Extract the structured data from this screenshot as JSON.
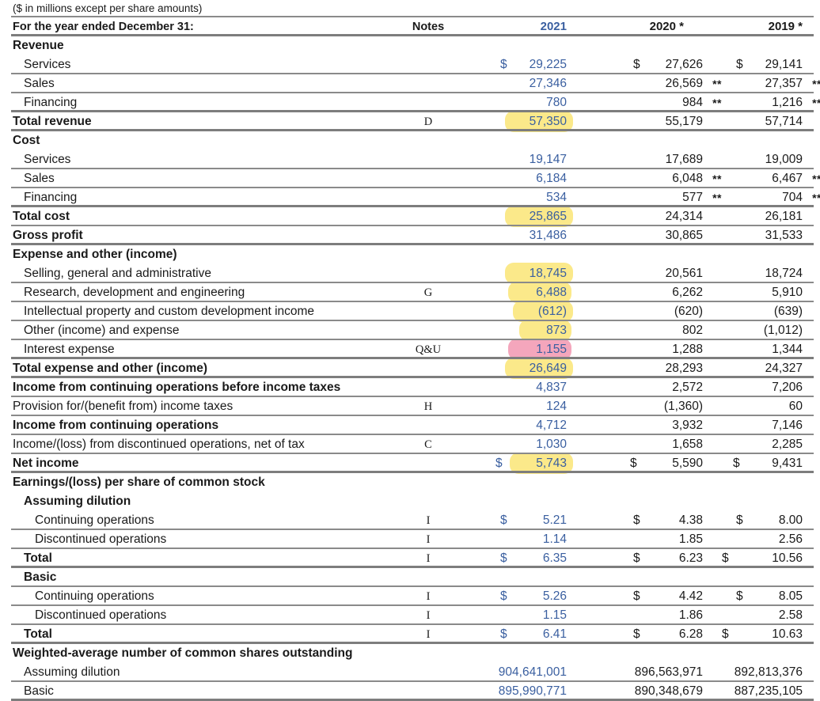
{
  "document": {
    "unit_note": "($ in millions except per share amounts)",
    "header": {
      "line_label": "For the year ended December 31:",
      "notes_label": "Notes",
      "col_2021": "2021",
      "col_2020": "2020 *",
      "col_2019": "2019 *"
    },
    "colors": {
      "accent_blue": "#3a5fa0",
      "highlight_yellow": "#fbe98a",
      "highlight_pink": "#f4a6bc",
      "rule_gray": "#8a8a8a",
      "text_dark": "#1a1a1a"
    }
  },
  "rows": [
    {
      "label": "Revenue",
      "notes": "",
      "v2021": "",
      "v2020": "",
      "v2019": ""
    },
    {
      "label": "Services",
      "notes": "",
      "cur2021": "$",
      "v2021": "29,225",
      "cur2020": "$",
      "v2020": "27,626",
      "cur2019": "$",
      "v2019": "29,141"
    },
    {
      "label": "Sales",
      "notes": "",
      "v2021": "27,346",
      "v2020": "26,569",
      "s2020": "**",
      "v2019": "27,357",
      "s2019": "**"
    },
    {
      "label": "Financing",
      "notes": "",
      "v2021": "780",
      "v2020": "984",
      "s2020": "**",
      "v2019": "1,216",
      "s2019": "**"
    },
    {
      "label": "Total revenue",
      "notes": "D",
      "v2021": "57,350",
      "v2020": "55,179",
      "v2019": "57,714"
    },
    {
      "label": "Cost",
      "notes": "",
      "v2021": "",
      "v2020": "",
      "v2019": ""
    },
    {
      "label": "Services",
      "notes": "",
      "v2021": "19,147",
      "v2020": "17,689",
      "v2019": "19,009"
    },
    {
      "label": "Sales",
      "notes": "",
      "v2021": "6,184",
      "v2020": "6,048",
      "s2020": "**",
      "v2019": "6,467",
      "s2019": "**"
    },
    {
      "label": "Financing",
      "notes": "",
      "v2021": "534",
      "v2020": "577",
      "s2020": "**",
      "v2019": "704",
      "s2019": "**"
    },
    {
      "label": "Total cost",
      "notes": "",
      "v2021": "25,865",
      "v2020": "24,314",
      "v2019": "26,181"
    },
    {
      "label": "Gross profit",
      "notes": "",
      "v2021": "31,486",
      "v2020": "30,865",
      "v2019": "31,533"
    },
    {
      "label": "Expense and other (income)",
      "notes": "",
      "v2021": "",
      "v2020": "",
      "v2019": ""
    },
    {
      "label": "Selling, general and administrative",
      "notes": "",
      "v2021": "18,745",
      "v2020": "20,561",
      "v2019": "18,724"
    },
    {
      "label": "Research, development and engineering",
      "notes": "G",
      "v2021": "6,488",
      "v2020": "6,262",
      "v2019": "5,910"
    },
    {
      "label": "Intellectual property and custom development income",
      "notes": "",
      "v2021": "(612)",
      "v2020": "(620)",
      "v2019": "(639)"
    },
    {
      "label": "Other (income) and expense",
      "notes": "",
      "v2021": "873",
      "v2020": "802",
      "v2019": "(1,012)"
    },
    {
      "label": "Interest expense",
      "notes": "Q&U",
      "v2021": "1,155",
      "v2020": "1,288",
      "v2019": "1,344"
    },
    {
      "label": "Total expense and other (income)",
      "notes": "",
      "v2021": "26,649",
      "v2020": "28,293",
      "v2019": "24,327"
    },
    {
      "label": "Income from continuing operations before income taxes",
      "notes": "",
      "v2021": "4,837",
      "v2020": "2,572",
      "v2019": "7,206"
    },
    {
      "label": "Provision for/(benefit from) income taxes",
      "notes": "H",
      "v2021": "124",
      "v2020": "(1,360)",
      "v2019": "60"
    },
    {
      "label": "Income from continuing operations",
      "notes": "",
      "v2021": "4,712",
      "v2020": "3,932",
      "v2019": "7,146"
    },
    {
      "label": "Income/(loss) from discontinued operations, net of tax",
      "notes": "C",
      "v2021": "1,030",
      "v2020": "1,658",
      "v2019": "2,285"
    },
    {
      "label": "Net income",
      "notes": "",
      "cur2021": "$",
      "v2021": "5,743",
      "cur2020": "$",
      "v2020": "5,590",
      "cur2019": "$",
      "v2019": "9,431"
    },
    {
      "label": "Earnings/(loss) per share of common stock",
      "notes": "",
      "v2021": "",
      "v2020": "",
      "v2019": ""
    },
    {
      "label": "Assuming dilution",
      "notes": "",
      "v2021": "",
      "v2020": "",
      "v2019": ""
    },
    {
      "label": "Continuing operations",
      "notes": "I",
      "cur2021": "$",
      "v2021": "5.21",
      "cur2020": "$",
      "v2020": "4.38",
      "cur2019": "$",
      "v2019": "8.00"
    },
    {
      "label": "Discontinued operations",
      "notes": "I",
      "v2021": "1.14",
      "v2020": "1.85",
      "v2019": "2.56"
    },
    {
      "label": "Total",
      "notes": "I",
      "cur2021": "$",
      "v2021": "6.35",
      "cur2020": "$",
      "v2020": "6.23",
      "cur2019": "$",
      "v2019": "10.56"
    },
    {
      "label": "Basic",
      "notes": "",
      "v2021": "",
      "v2020": "",
      "v2019": ""
    },
    {
      "label": "Continuing operations",
      "notes": "I",
      "cur2021": "$",
      "v2021": "5.26",
      "cur2020": "$",
      "v2020": "4.42",
      "cur2019": "$",
      "v2019": "8.05"
    },
    {
      "label": "Discontinued operations",
      "notes": "I",
      "v2021": "1.15",
      "v2020": "1.86",
      "v2019": "2.58"
    },
    {
      "label": "Total",
      "notes": "I",
      "cur2021": "$",
      "v2021": "6.41",
      "cur2020": "$",
      "v2020": "6.28",
      "cur2019": "$",
      "v2019": "10.63"
    },
    {
      "label": "Weighted-average number of common shares outstanding",
      "notes": "",
      "v2021": "",
      "v2020": "",
      "v2019": ""
    },
    {
      "label": "Assuming dilution",
      "notes": "",
      "v2021": "904,641,001",
      "v2020": "896,563,971",
      "v2019": "892,813,376"
    },
    {
      "label": "Basic",
      "notes": "",
      "v2021": "895,990,771",
      "v2020": "890,348,679",
      "v2019": "887,235,105"
    }
  ]
}
